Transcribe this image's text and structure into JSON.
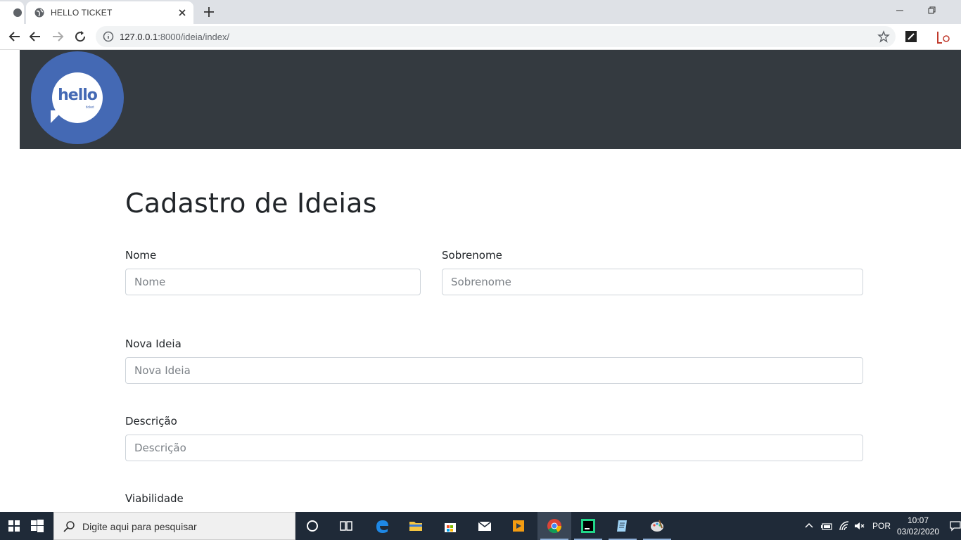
{
  "browser": {
    "tab_title": "HELLO TICKET",
    "url_host": "127.0.0.1",
    "url_path": ":8000/ideia/index/"
  },
  "brand": {
    "logo_text": "hello",
    "logo_sub": "ticket",
    "logo_color": "#4469b4",
    "navbar_color": "#343a40"
  },
  "form": {
    "title": "Cadastro de Ideias",
    "nome": {
      "label": "Nome",
      "placeholder": "Nome"
    },
    "sobrenome": {
      "label": "Sobrenome",
      "placeholder": "Sobrenome"
    },
    "nova_ideia": {
      "label": "Nova Ideia",
      "placeholder": "Nova Ideia"
    },
    "descricao": {
      "label": "Descrição",
      "placeholder": "Descrição"
    },
    "viabilidade": {
      "label": "Viabilidade"
    }
  },
  "taskbar": {
    "search_placeholder": "Digite aqui para pesquisar",
    "language": "POR",
    "time": "10:07",
    "date": "03/02/2020"
  }
}
